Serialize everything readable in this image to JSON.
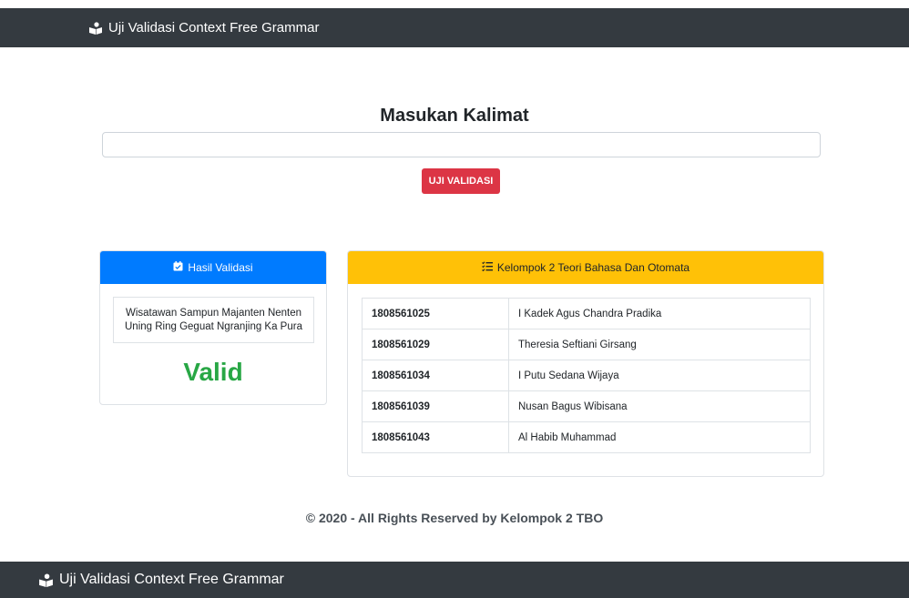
{
  "navbar": {
    "brand": "Uji Validasi Context Free Grammar"
  },
  "form": {
    "title": "Masukan Kalimat",
    "input_value": "",
    "button_label": "UJI VALIDASI"
  },
  "result_card": {
    "header": "Hasil Validasi",
    "sentence": "Wisatawan Sampun Majanten Nenten Uning Ring Geguat Ngranjing Ka Pura",
    "status": "Valid",
    "status_color": "#28a745"
  },
  "group_card": {
    "header": "Kelompok 2 Teori Bahasa Dan Otomata",
    "members": [
      {
        "nim": "1808561025",
        "name": "I Kadek Agus Chandra Pradika"
      },
      {
        "nim": "1808561029",
        "name": "Theresia Seftiani Girsang"
      },
      {
        "nim": "1808561034",
        "name": "I Putu Sedana Wijaya"
      },
      {
        "nim": "1808561039",
        "name": "Nusan Bagus Wibisana"
      },
      {
        "nim": "1808561043",
        "name": "Al Habib Muhammad"
      }
    ]
  },
  "footer": {
    "text": "© 2020 - All Rights Reserved by Kelompok 2 TBO"
  },
  "bottom_navbar": {
    "brand": "Uji Validasi Context Free Grammar"
  },
  "colors": {
    "navbar": "#343a40",
    "primary": "#007bff",
    "warning": "#ffc107",
    "danger": "#dc3545",
    "success": "#28a745"
  },
  "icons": {
    "brand": "reader-book-icon",
    "result_header": "calendar-check-icon",
    "group_header": "tasks-list-icon"
  }
}
